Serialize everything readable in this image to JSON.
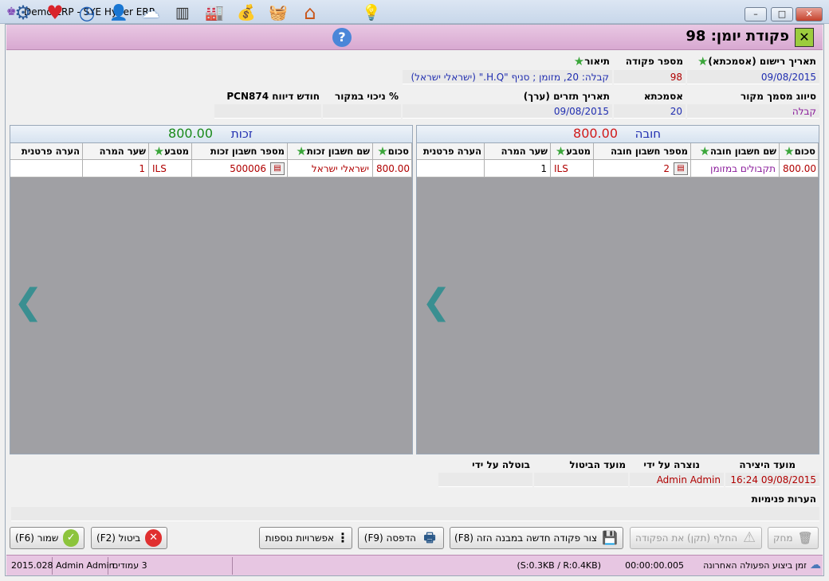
{
  "window": {
    "title": "Demo ERP - SYE Hyper ERP",
    "min_glyph": "–",
    "max_glyph": "□",
    "close_glyph": "✕"
  },
  "toolbar": {
    "icons": [
      {
        "name": "lightbulb-icon",
        "glyph": "💡"
      },
      {
        "name": "help-icon",
        "glyph": "?"
      },
      {
        "name": "home-icon",
        "glyph": "⌂"
      },
      {
        "name": "basket-icon",
        "glyph": "🧺"
      },
      {
        "name": "money-icon",
        "glyph": "💰"
      },
      {
        "name": "factory-icon",
        "glyph": "🏭"
      },
      {
        "name": "barcode-icon",
        "glyph": "▥"
      },
      {
        "name": "cloud-icon",
        "glyph": "☁"
      },
      {
        "name": "user-icon",
        "glyph": "👤"
      },
      {
        "name": "clock-icon",
        "glyph": "◷"
      },
      {
        "name": "heart-icon",
        "glyph": "♥"
      },
      {
        "name": "gear-icon",
        "glyph": "⚙"
      }
    ]
  },
  "page_title": "פקודת יומן: 98",
  "header": {
    "reg_date_label": "תאריך רישום (אסמכתא)",
    "reg_date": "09/08/2015",
    "order_no_label": "מספר פקודה",
    "order_no": "98",
    "description_label": "תיאור",
    "description": "קבלה: 20, מזומן ; סניף \"H.Q.\" (ישראלי ישראל)",
    "source_class_label": "סיווג מסמך מקור",
    "source_class": "קבלה",
    "reference_label": "אסמכתא",
    "reference": "20",
    "value_date_label": "תאריך תזרים (ערך)",
    "value_date": "09/08/2015",
    "withholding_label": "% ניכוי במקור",
    "withholding": "",
    "report_month_label": "חודש דיווח",
    "report_month": "PCN874"
  },
  "debit": {
    "title": "חובה",
    "total": "800.00",
    "columns": [
      "סכום",
      "שם חשבון חובה",
      "מספר חשבון חובה",
      "מטבע",
      "שער המרה",
      "הערה פרטנית"
    ],
    "rows": [
      {
        "amount": "800.00",
        "account_name": "תקבולים במזומן",
        "account_no": "2",
        "currency": "ILS",
        "rate": "1",
        "note": ""
      }
    ]
  },
  "credit": {
    "title": "זכות",
    "total": "800.00",
    "columns": [
      "סכום",
      "שם חשבון זכות",
      "מספר חשבון זכות",
      "מטבע",
      "שער המרה",
      "הערה פרטנית"
    ],
    "rows": [
      {
        "amount": "800.00",
        "account_name": "ישראלי ישראל",
        "account_no": "500006",
        "currency": "ILS",
        "rate": "1",
        "note": ""
      }
    ]
  },
  "audit": {
    "created_at_label": "מועד היצירה",
    "created_at": "09/08/2015 16:24",
    "created_by_label": "נוצרה על ידי",
    "created_by": "Admin Admin",
    "cancel_at_label": "מועד הביטול",
    "cancel_at": "",
    "cancel_by_label": "בוטלה על ידי",
    "cancel_by": "",
    "internal_notes_label": "הערות פנימיות",
    "internal_notes": ""
  },
  "buttons": {
    "delete": "מחק",
    "replace": "החלף (תקן) את הפקודה",
    "create_new": "צור פקודה חדשה במבנה הזה (F8)",
    "print": "הדפסה (F9)",
    "more": "אפשרויות נוספות",
    "cancel": "ביטול (F2)",
    "save": "שמור (F6)"
  },
  "status": {
    "last_action": "זמן ביצוע הפעולה האחרונה",
    "elapsed": "00:00:00.005",
    "size": "(S:0.3KB / R:0.4KB)",
    "pages": "3 עמודים",
    "user": "Admin Admin",
    "version": "2015.028"
  },
  "colors": {
    "debit_total": "#d11a1a",
    "credit_total": "#1a8a1a",
    "link_blue": "#1f2db0",
    "dark_red": "#b00000",
    "purple": "#8a1a9a"
  }
}
